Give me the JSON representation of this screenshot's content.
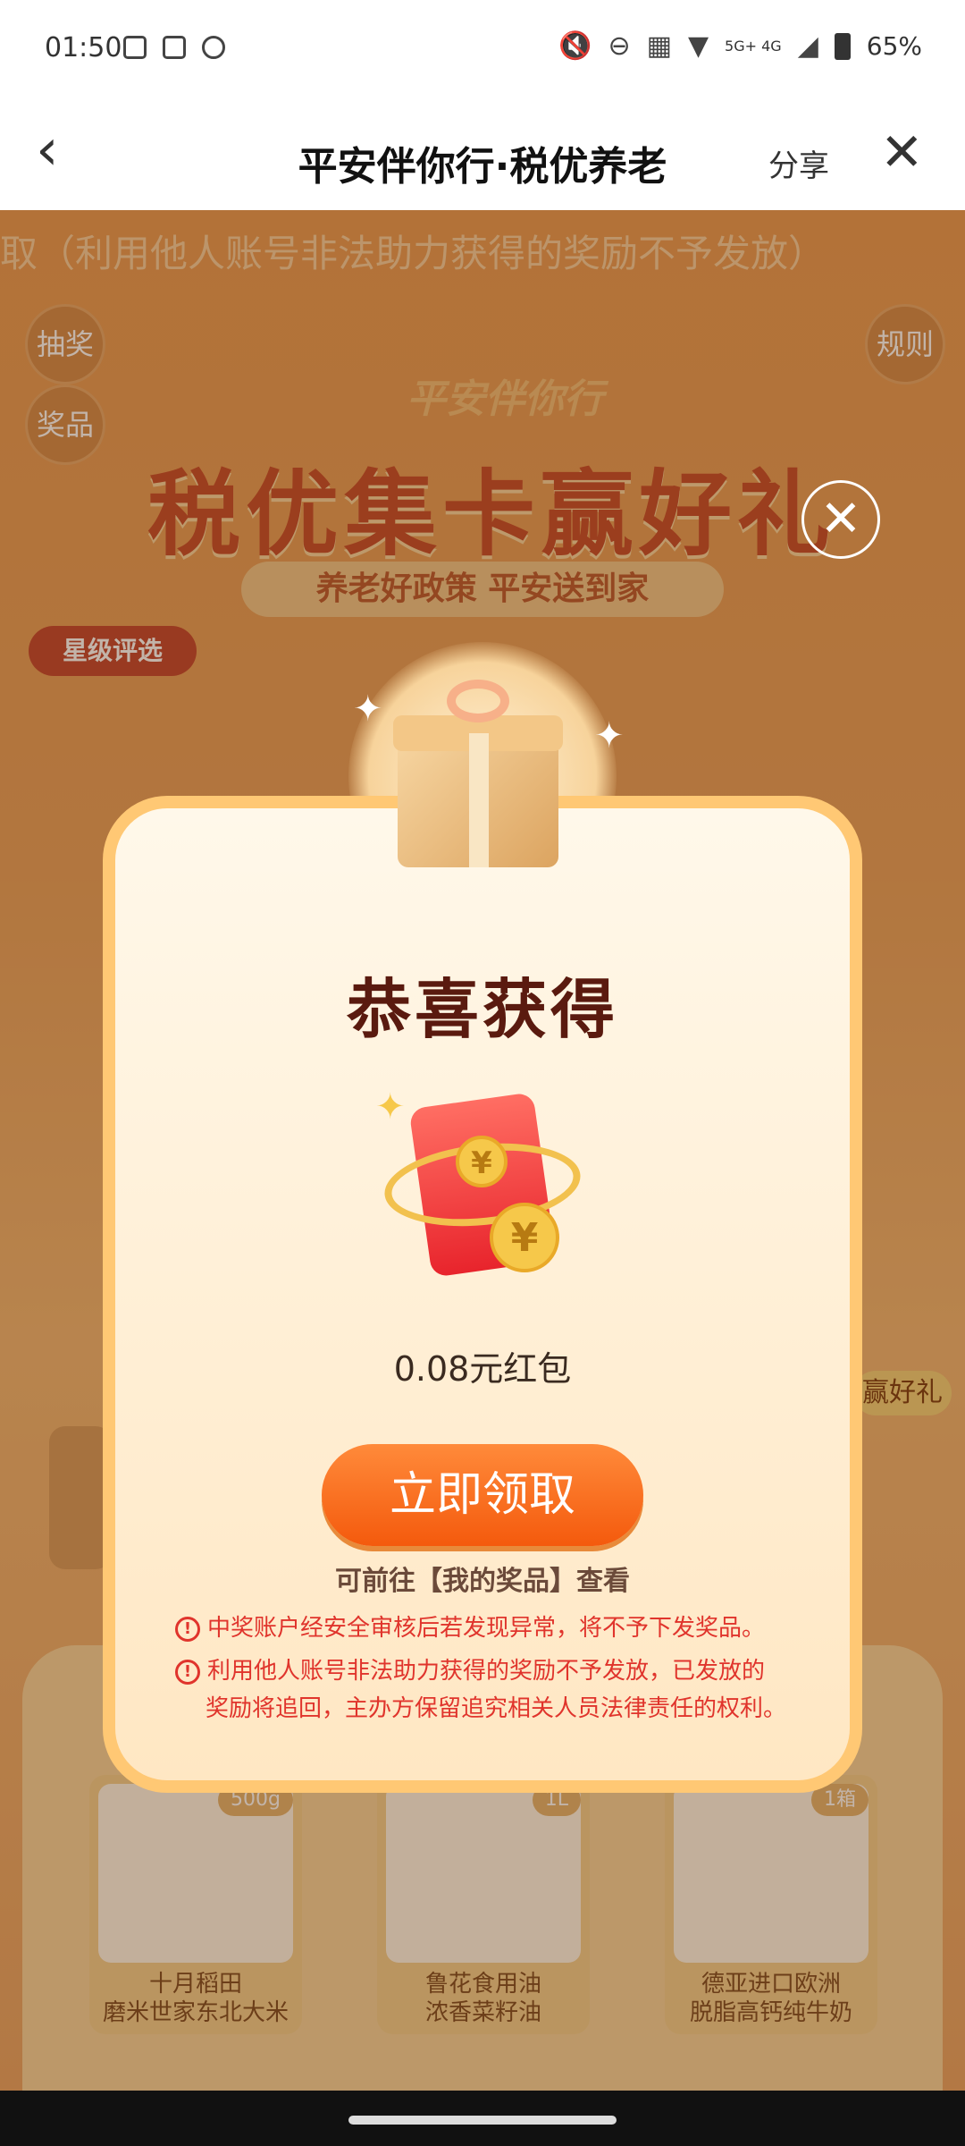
{
  "status_bar": {
    "time": "01:50",
    "network": "5G+ 4G",
    "battery": "65%"
  },
  "title_bar": {
    "back_icon": "chevron-left-icon",
    "title": "平安伴你行·税优养老",
    "share_label": "分享",
    "close_icon": "close-icon"
  },
  "background": {
    "marquee_text": "取（利用他人账号非法助力获得的奖励不予发放）",
    "left_buttons": [
      "抽奖",
      "奖品"
    ],
    "rules_button": "规则",
    "hero_logo": "平安伴你行",
    "hero_title": "税优集卡赢好礼",
    "hero_subtitle": "养老好政策 平安送到家",
    "star_rating_button": "星级评选",
    "right_tag": "赢好礼",
    "products": [
      {
        "badge": "500g",
        "name_line1": "十月稻田",
        "name_line2": "磨米世家东北大米"
      },
      {
        "badge": "1L",
        "name_line1": "鲁花食用油",
        "name_line2": "浓香菜籽油"
      },
      {
        "badge": "1箱",
        "name_line1": "德亚进口欧洲",
        "name_line2": "脱脂高钙纯牛奶"
      }
    ]
  },
  "modal": {
    "title": "恭喜获得",
    "prize": "0.08元红包",
    "claim_button": "立即领取",
    "hint": "可前往【我的奖品】查看",
    "warnings": [
      "中奖账户经安全审核后若发现异常，将不予下发奖品。",
      "利用他人账号非法助力获得的奖励不予发放，已发放的",
      "奖励将追回，主办方保留追究相关人员法律责任的权利。"
    ],
    "coin_symbol": "¥"
  },
  "colors": {
    "modal_border": "#ffc874",
    "claim_button": "#f45a0d",
    "title_text": "#5a1a0f",
    "warning_text": "#e0342c"
  }
}
